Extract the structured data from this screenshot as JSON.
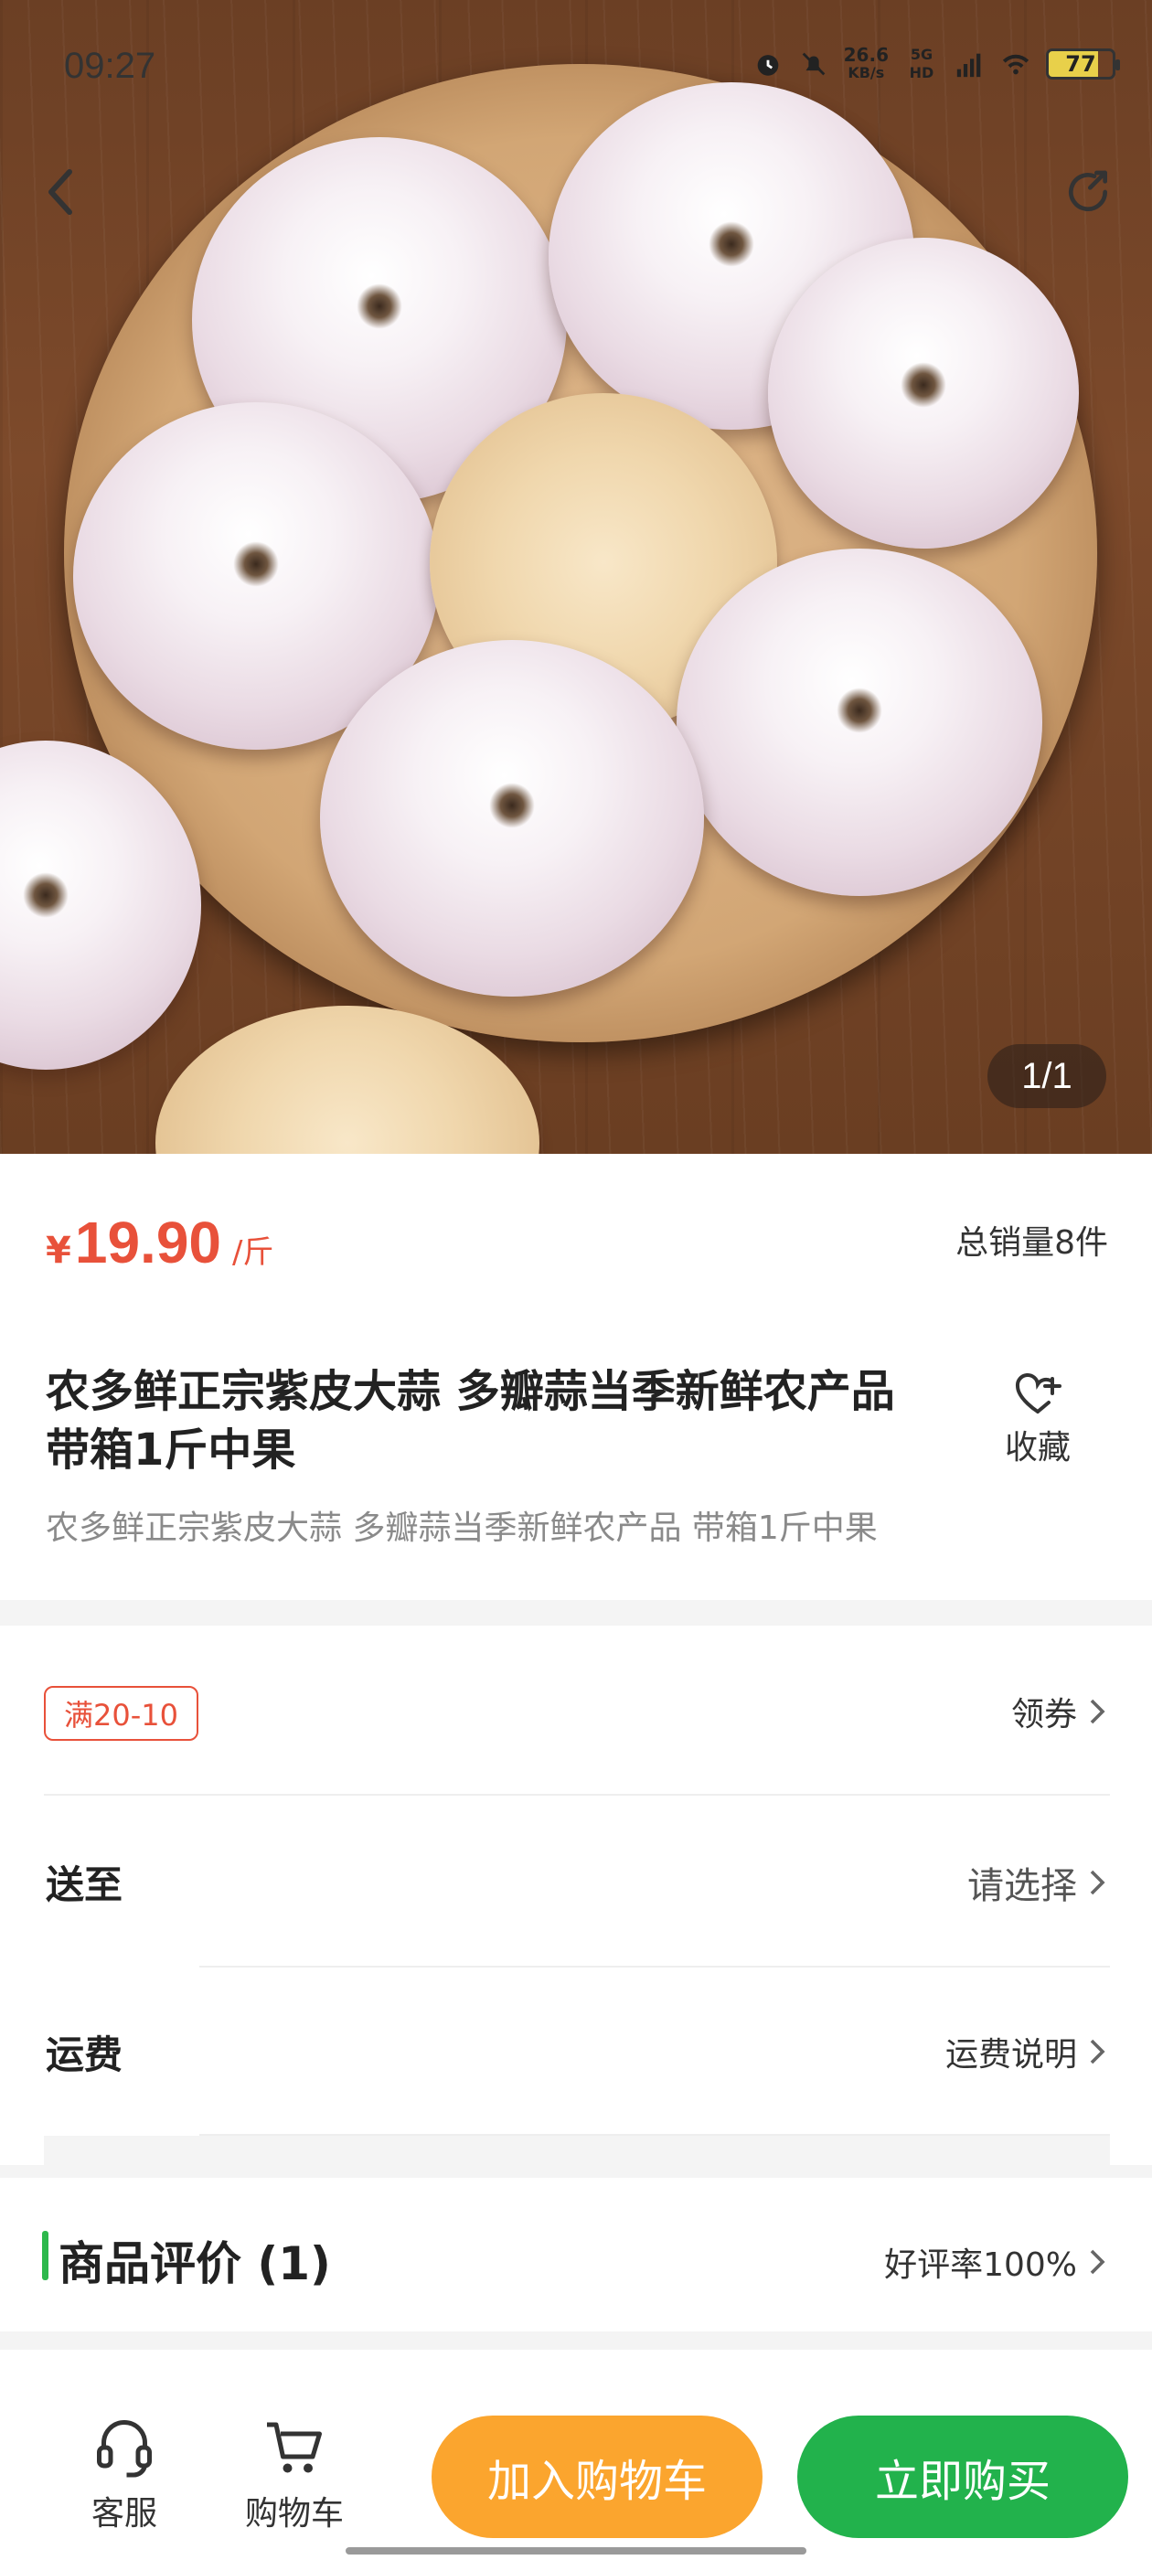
{
  "status_bar": {
    "time": "09:27",
    "net_speed_value": "26.6",
    "net_speed_unit": "KB/s",
    "signal_label": "5G HD",
    "battery": "77",
    "icons": [
      "alarm-icon",
      "mute-icon",
      "signal-icon",
      "wifi-icon",
      "battery-icon"
    ]
  },
  "gallery": {
    "counter": "1/1",
    "icons": [
      "back-arrow-icon",
      "share-icon"
    ]
  },
  "product": {
    "currency": "¥",
    "price": "19.90",
    "unit": "/斤",
    "sales": "总销量8件",
    "title": "农多鲜正宗紫皮大蒜 多瓣蒜当季新鲜农产品 带箱1斤中果",
    "subtitle": "农多鲜正宗紫皮大蒜 多瓣蒜当季新鲜农产品 带箱1斤中果",
    "favorite_label": "收藏"
  },
  "promotions": {
    "coupon_tag": "满20-10",
    "coupon_action": "领券"
  },
  "delivery": {
    "ship_to_label": "送至",
    "ship_to_value": "请选择",
    "freight_label": "运费",
    "freight_value": "运费说明"
  },
  "reviews": {
    "title": "商品评价 (1)",
    "rating": "好评率100%"
  },
  "bottom_bar": {
    "service_label": "客服",
    "cart_label": "购物车",
    "add_to_cart": "加入购物车",
    "buy_now": "立即购买"
  },
  "colors": {
    "price_red": "#e8513a",
    "cart_orange": "#fba52e",
    "buy_green": "#22b24c",
    "accent_green": "#2db84c"
  }
}
